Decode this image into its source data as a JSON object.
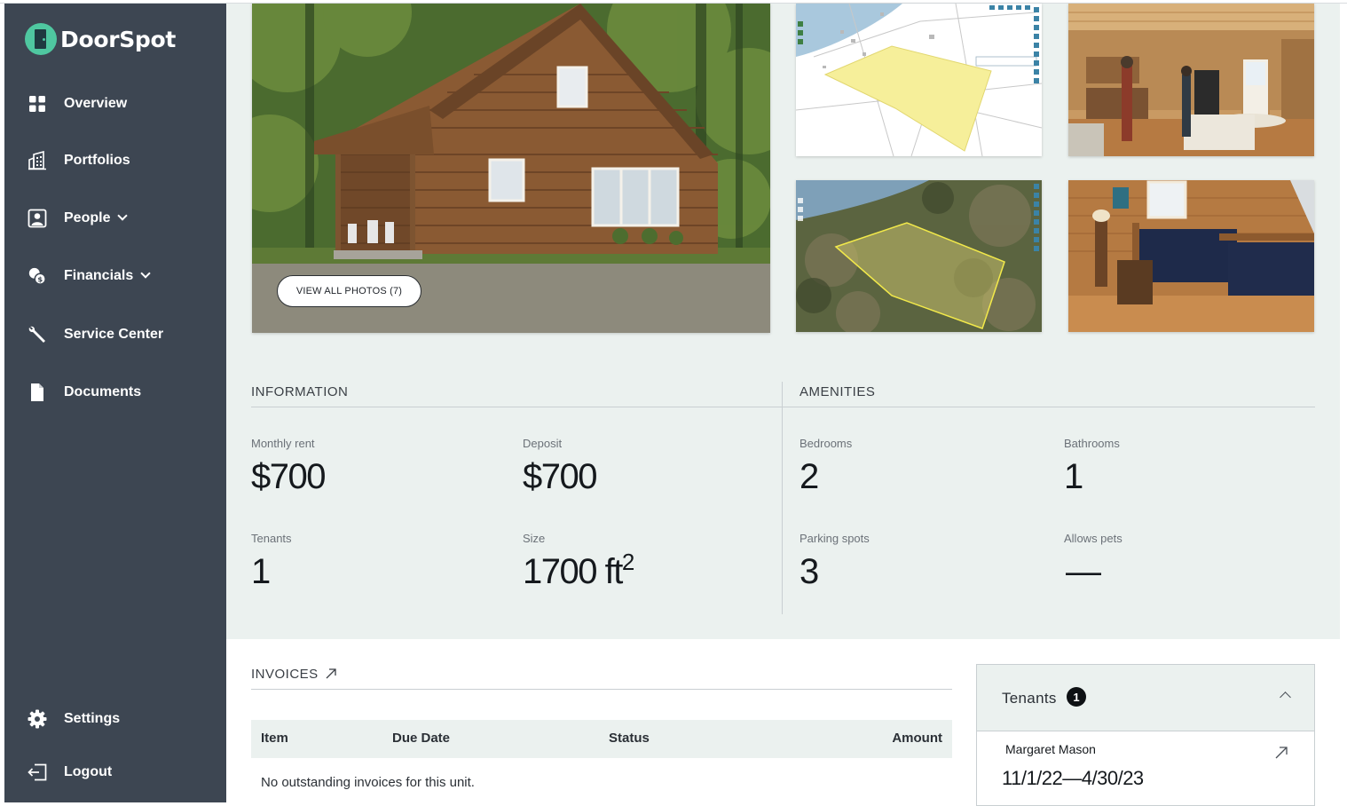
{
  "app": {
    "name": "DoorSpot"
  },
  "sidebar": {
    "items": [
      {
        "label": "Overview",
        "icon": "grid-icon"
      },
      {
        "label": "Portfolios",
        "icon": "buildings-icon"
      },
      {
        "label": "People",
        "icon": "person-icon",
        "expandable": true
      },
      {
        "label": "Financials",
        "icon": "coins-icon",
        "expandable": true
      },
      {
        "label": "Service Center",
        "icon": "wrench-icon"
      },
      {
        "label": "Documents",
        "icon": "document-icon"
      }
    ],
    "bottom": [
      {
        "label": "Settings",
        "icon": "gear-icon"
      },
      {
        "label": "Logout",
        "icon": "logout-icon"
      }
    ]
  },
  "gallery": {
    "view_all_label": "VIEW ALL PHOTOS (7)"
  },
  "information": {
    "heading": "INFORMATION",
    "monthly_rent": {
      "label": "Monthly rent",
      "value": "$700"
    },
    "deposit": {
      "label": "Deposit",
      "value": "$700"
    },
    "tenants": {
      "label": "Tenants",
      "value": "1"
    },
    "size": {
      "label": "Size",
      "value": "1700 ft",
      "unit_exp": "2"
    }
  },
  "amenities": {
    "heading": "AMENITIES",
    "bedrooms": {
      "label": "Bedrooms",
      "value": "2"
    },
    "bathrooms": {
      "label": "Bathrooms",
      "value": "1"
    },
    "parking": {
      "label": "Parking spots",
      "value": "3"
    },
    "pets": {
      "label": "Allows pets",
      "value": "—"
    }
  },
  "invoices": {
    "heading": "INVOICES",
    "columns": [
      "Item",
      "Due Date",
      "Status",
      "Amount"
    ],
    "empty_message": "No outstanding invoices for this unit."
  },
  "tenants_panel": {
    "title": "Tenants",
    "count": "1",
    "tenant": {
      "name": "Margaret Mason",
      "lease": "11/1/22—4/30/23"
    }
  },
  "colors": {
    "sidebar": "#3d4652",
    "accent": "#4fc7a0",
    "panel": "#ebf1ef",
    "map_parcel": "#f6ef9a"
  }
}
